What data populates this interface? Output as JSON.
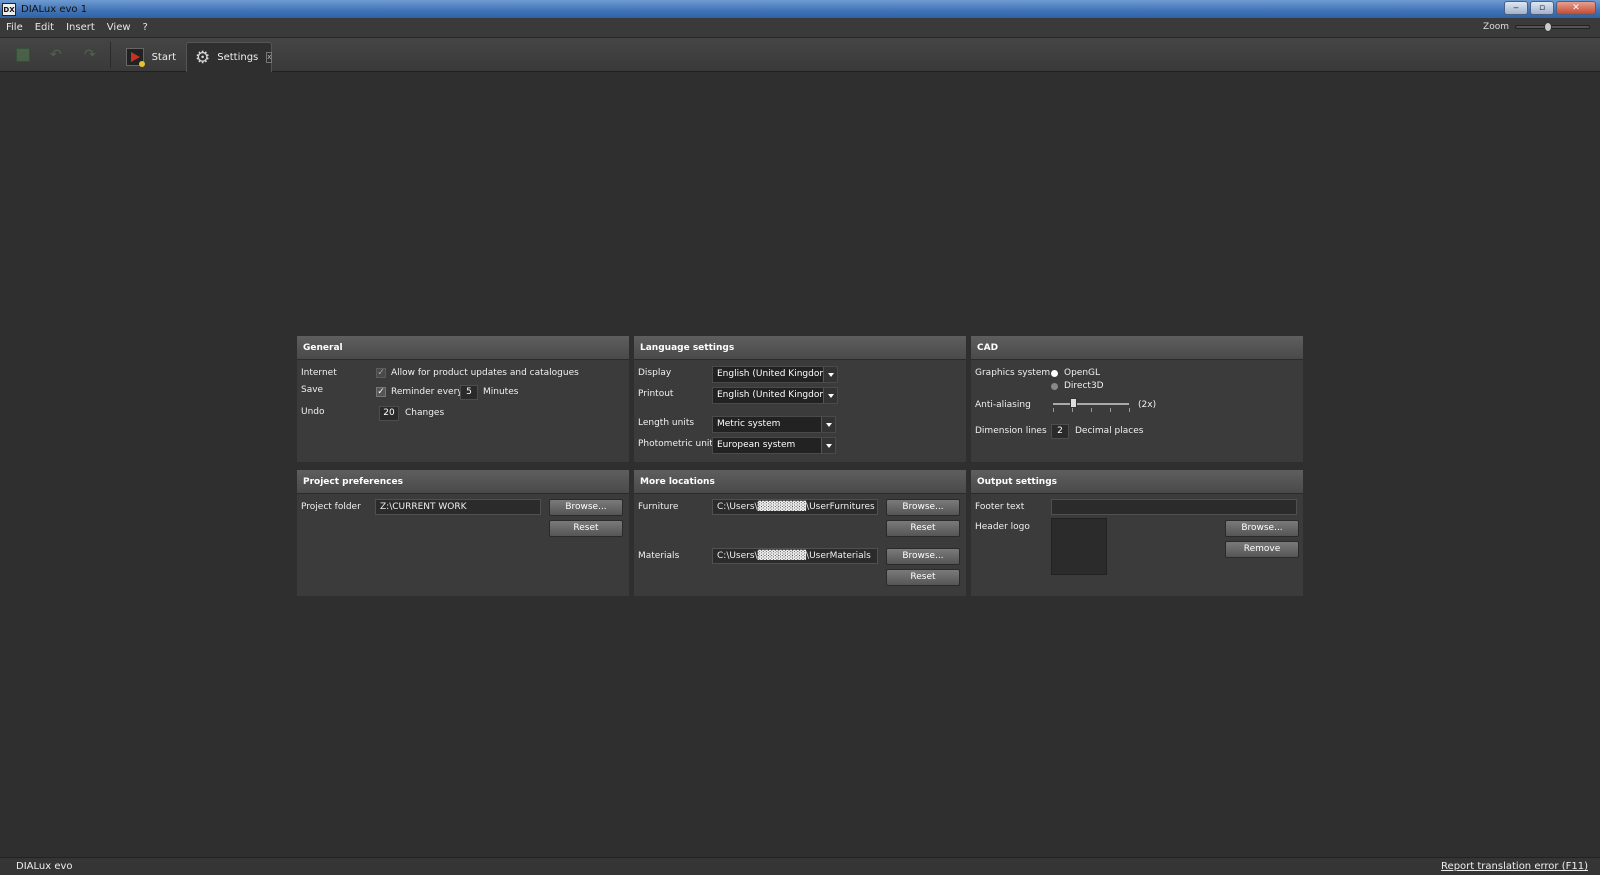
{
  "window": {
    "app_icon": "DX",
    "title": "DIALux evo 1",
    "minimize": "‒",
    "maximize": "▫",
    "close": "✕"
  },
  "menu": {
    "items": [
      "File",
      "Edit",
      "Insert",
      "View",
      "?"
    ],
    "zoom_label": "Zoom"
  },
  "toolbar": {
    "icons": [
      "save-icon",
      "undo-icon",
      "redo-icon"
    ],
    "tabs": [
      {
        "label": "Start",
        "icon": "start-icon"
      },
      {
        "label": "Settings",
        "icon": "gear-icon",
        "close": "x"
      }
    ]
  },
  "general": {
    "title": "General",
    "internet_label": "Internet",
    "internet_checkbox_label": "Allow for product updates and catalogues",
    "save_label": "Save",
    "reminder_label": "Reminder every",
    "reminder_value": "5",
    "minutes_label": "Minutes",
    "undo_label": "Undo",
    "undo_value": "20",
    "changes_label": "Changes"
  },
  "language": {
    "title": "Language settings",
    "display_label": "Display",
    "display_value": "English (United Kingdom)",
    "printout_label": "Printout",
    "printout_value": "English (United Kingdom)",
    "length_label": "Length units",
    "length_value": "Metric system",
    "photometric_label": "Photometric units",
    "photometric_value": "European system"
  },
  "cad": {
    "title": "CAD",
    "graphics_label": "Graphics system",
    "opengl": "OpenGL",
    "direct3d": "Direct3D",
    "antialias_label": "Anti-aliasing",
    "antialias_value": "(2x)",
    "dimension_label": "Dimension lines",
    "dimension_value": "2",
    "decimal_label": "Decimal places"
  },
  "project": {
    "title": "Project preferences",
    "folder_label": "Project folder",
    "folder_value": "Z:\\CURRENT WORK",
    "browse": "Browse...",
    "reset": "Reset"
  },
  "locations": {
    "title": "More locations",
    "furniture_label": "Furniture",
    "furniture_value": "C:\\Users\\▓▓▓▓▓▓▓\\UserFurnitures",
    "materials_label": "Materials",
    "materials_value": "C:\\Users\\▓▓▓▓▓▓▓\\UserMaterials",
    "browse": "Browse...",
    "reset": "Reset"
  },
  "output": {
    "title": "Output settings",
    "footer_label": "Footer text",
    "footer_value": "",
    "header_logo_label": "Header logo",
    "browse": "Browse...",
    "remove": "Remove"
  },
  "status": {
    "left": "DIALux evo",
    "right": "Report translation error (F11)"
  }
}
